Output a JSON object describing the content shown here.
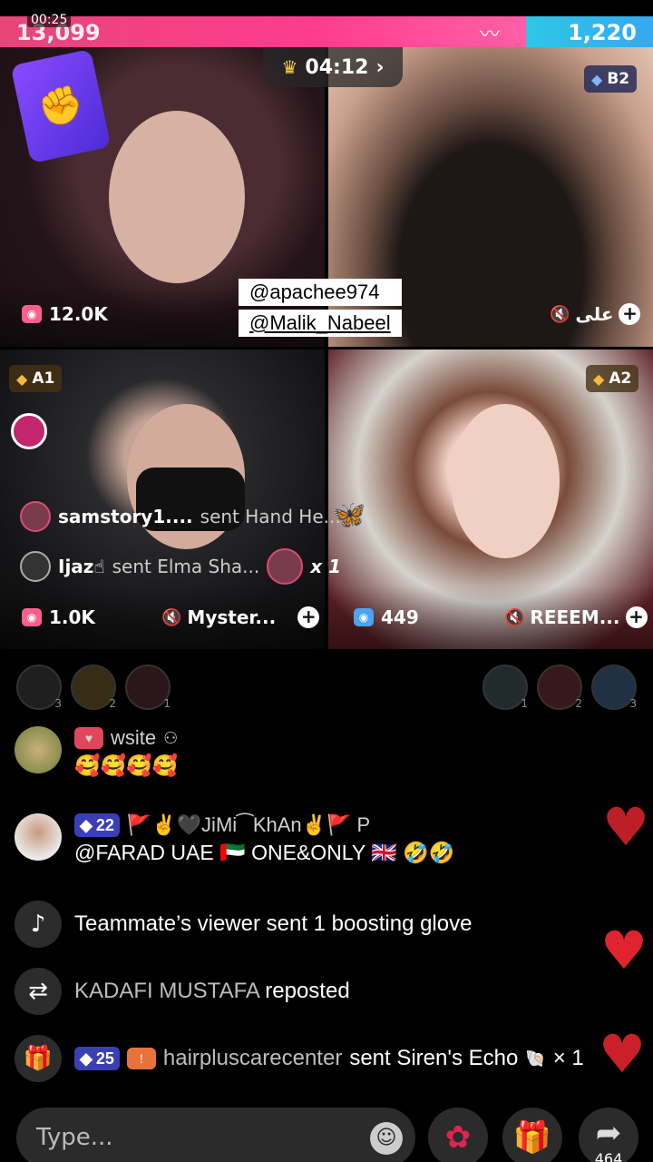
{
  "status": {
    "clock": "00:25"
  },
  "battle": {
    "score_left": "13,099",
    "score_right": "1,220"
  },
  "timer": {
    "value": "04:12"
  },
  "tiles": {
    "t1": {
      "viewers": "12.0K"
    },
    "t2": {
      "badge": "B2",
      "name": "علی"
    },
    "t3": {
      "badge": "A1",
      "viewers": "1.0K",
      "name": "Myster..."
    },
    "t4": {
      "badge": "A2",
      "viewers": "449",
      "name": "REEEM..."
    }
  },
  "handles": {
    "first": "@apachee974",
    "second": "@Malik_Nabeel"
  },
  "gift_feed": [
    {
      "user": "samstory1....",
      "text": "sent Hand He..."
    },
    {
      "user": "Ijaz☝",
      "text": "sent Elma Sha...",
      "count": "x 1"
    }
  ],
  "viewer_ranks": [
    "3",
    "2",
    "1",
    "1",
    "2",
    "3"
  ],
  "chat": [
    {
      "user": "wsite",
      "message": "🥰🥰🥰🥰"
    },
    {
      "level": "22",
      "user": "🚩✌🖤JiMi⁀KhAn✌🚩 P",
      "message": "@FARAD UAE 🇦🇪 ONE&ONLY 🇬🇧 🤣🤣"
    },
    {
      "text": "Teammate’s viewer sent 1 boosting glove"
    },
    {
      "user": "KADAFI MUSTAFA",
      "text": "reposted"
    },
    {
      "level": "25",
      "user": "hairpluscarecenter",
      "text": "sent Siren's Echo",
      "count": "× 1"
    }
  ],
  "input": {
    "placeholder": "Type..."
  },
  "share": {
    "count": "464"
  },
  "icons": {
    "diamond": "diamond-icon",
    "viewers": "viewer-count-icon",
    "mute": "mute-icon",
    "add": "plus-icon",
    "tiktok": "tiktok-icon",
    "repost": "repost-icon",
    "gift": "gift-icon",
    "emoji": "emoji-icon",
    "rose": "rose-icon",
    "share": "share-icon",
    "heart": "heart-icon"
  },
  "colors": {
    "left_team": "#ff3c8e",
    "right_team": "#35a9f0",
    "heart": "#e0242f"
  }
}
